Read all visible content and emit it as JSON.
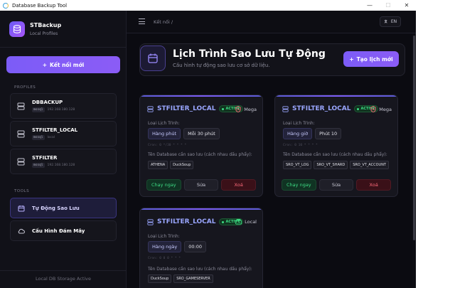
{
  "window": {
    "title": "Database Backup Tool"
  },
  "brand": {
    "name": "STBackup",
    "subtitle": "Local Profiles"
  },
  "sidebar": {
    "new_connection": "Kết nối mới",
    "profiles_label": "PROFILES",
    "profiles": [
      {
        "name": "DBBACKUP",
        "type": "mssql",
        "host": "192.168.180.128"
      },
      {
        "name": "STFILTER_LOCAL",
        "type": "mssql",
        "host": "local"
      },
      {
        "name": "STFILTER",
        "type": "mssql",
        "host": "192.168.180.128"
      }
    ],
    "tools_label": "TOOLS",
    "tools": [
      {
        "label": "Tự Động Sao Lưu",
        "active": true
      },
      {
        "label": "Cấu Hình Đám Mây",
        "active": false
      }
    ],
    "footer": "Local DB Storage Active"
  },
  "topbar": {
    "breadcrumb": "Kết nối  /",
    "language": "EN"
  },
  "header": {
    "title": "Lịch Trình Sao Lưu Tự Động",
    "subtitle": "Cấu hình tự động sao lưu cơ sở dữ liệu.",
    "create_label": "Tạo lịch mới"
  },
  "jobs": [
    {
      "name": "STFILTER_LOCAL",
      "status": "ACTIVE",
      "storage": "Mega",
      "schedule_label": "Loại Lịch Trình:",
      "schedule_type": "Hàng phút",
      "schedule_value": "Mỗi 30 phút",
      "cron": "Cron: 0 */30 * * * *",
      "db_label": "Tên Database cần sao lưu (cách nhau dấu phẩy):",
      "databases": [
        "ATHENA",
        "DuckSoup"
      ],
      "run": "Chạy ngay",
      "edit": "Sửa",
      "delete": "Xoá"
    },
    {
      "name": "STFILTER_LOCAL",
      "status": "ACTIVE",
      "storage": "Mega",
      "schedule_label": "Loại Lịch Trình:",
      "schedule_type": "Hàng giờ",
      "schedule_value": "Phút 10",
      "cron": "Cron: 0 10 * * * *",
      "db_label": "Tên Database cần sao lưu (cách nhau dấu phẩy):",
      "databases": [
        "SRO_VT_LOG",
        "SRO_VT_SHARD",
        "SRO_VT_ACCOUNT"
      ],
      "run": "Chạy ngay",
      "edit": "Sửa",
      "delete": "Xoá"
    },
    {
      "name": "STFILTER_LOCAL",
      "status": "ACTIVE",
      "storage": "Local",
      "schedule_label": "Loại Lịch Trình:",
      "schedule_type": "Hàng ngày",
      "schedule_value": "00:00",
      "cron": "Cron: 0 0 0 * * *",
      "db_label": "Tên Database cần sao lưu (cách nhau dấu phẩy):",
      "databases": [
        "DuckSoup",
        "SRO_GAMESERVER"
      ]
    }
  ],
  "colors": {
    "accent": "#7c5cf7",
    "active_green": "#3ddc84",
    "danger": "#ff6b7b",
    "background": "#0b0b11"
  }
}
